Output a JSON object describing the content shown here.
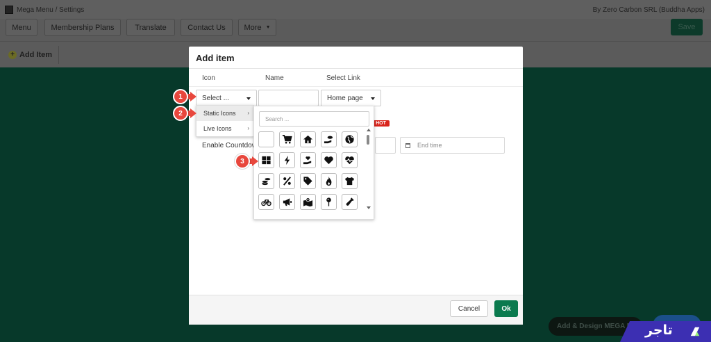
{
  "app": {
    "breadcrumb": "Mega Menu / Settings",
    "by_line": "By Zero Carbon SRL (Buddha Apps)",
    "nav": [
      "Menu",
      "Membership Plans",
      "Translate",
      "Contact Us",
      "More"
    ],
    "save_label": "Save",
    "add_item_label": "Add Item",
    "mega_pill_label": "Add & Design MEGA M",
    "brand_text": "تاجر"
  },
  "modal": {
    "title": "Add item",
    "col_icon": "Icon",
    "col_name": "Name",
    "col_link": "Select Link",
    "icon_select_value": "Select ...",
    "link_select_value": "Home page",
    "hot_badge": "HOT",
    "enable_countdown_label": "Enable Countdown",
    "end_time_placeholder": "End time",
    "cancel_label": "Cancel",
    "ok_label": "Ok"
  },
  "icon_menu": {
    "items": [
      {
        "label": "Static Icons",
        "active": true
      },
      {
        "label": "Live Icons",
        "active": false
      }
    ]
  },
  "icon_picker": {
    "search_placeholder": "Search ...",
    "icons": [
      "blank-icon",
      "cart-icon",
      "home-icon",
      "coins-hand-icon",
      "globe-icon",
      "th-large-icon",
      "bolt-icon",
      "hand-heart-icon",
      "heart-icon",
      "heartbeat-icon",
      "coins-icon",
      "percent-icon",
      "tag-icon",
      "fire-icon",
      "tshirt-icon",
      "bicycle-icon",
      "bullhorn-icon",
      "map-marked-icon",
      "map-pin-icon",
      "bottle-icon"
    ]
  },
  "markers": [
    "1",
    "2",
    "3"
  ],
  "colors": {
    "accent_green": "#0b7a4e",
    "marker_red": "#e8473d",
    "hot_red": "#d9251c",
    "brand_purple": "#3c2fb2"
  }
}
